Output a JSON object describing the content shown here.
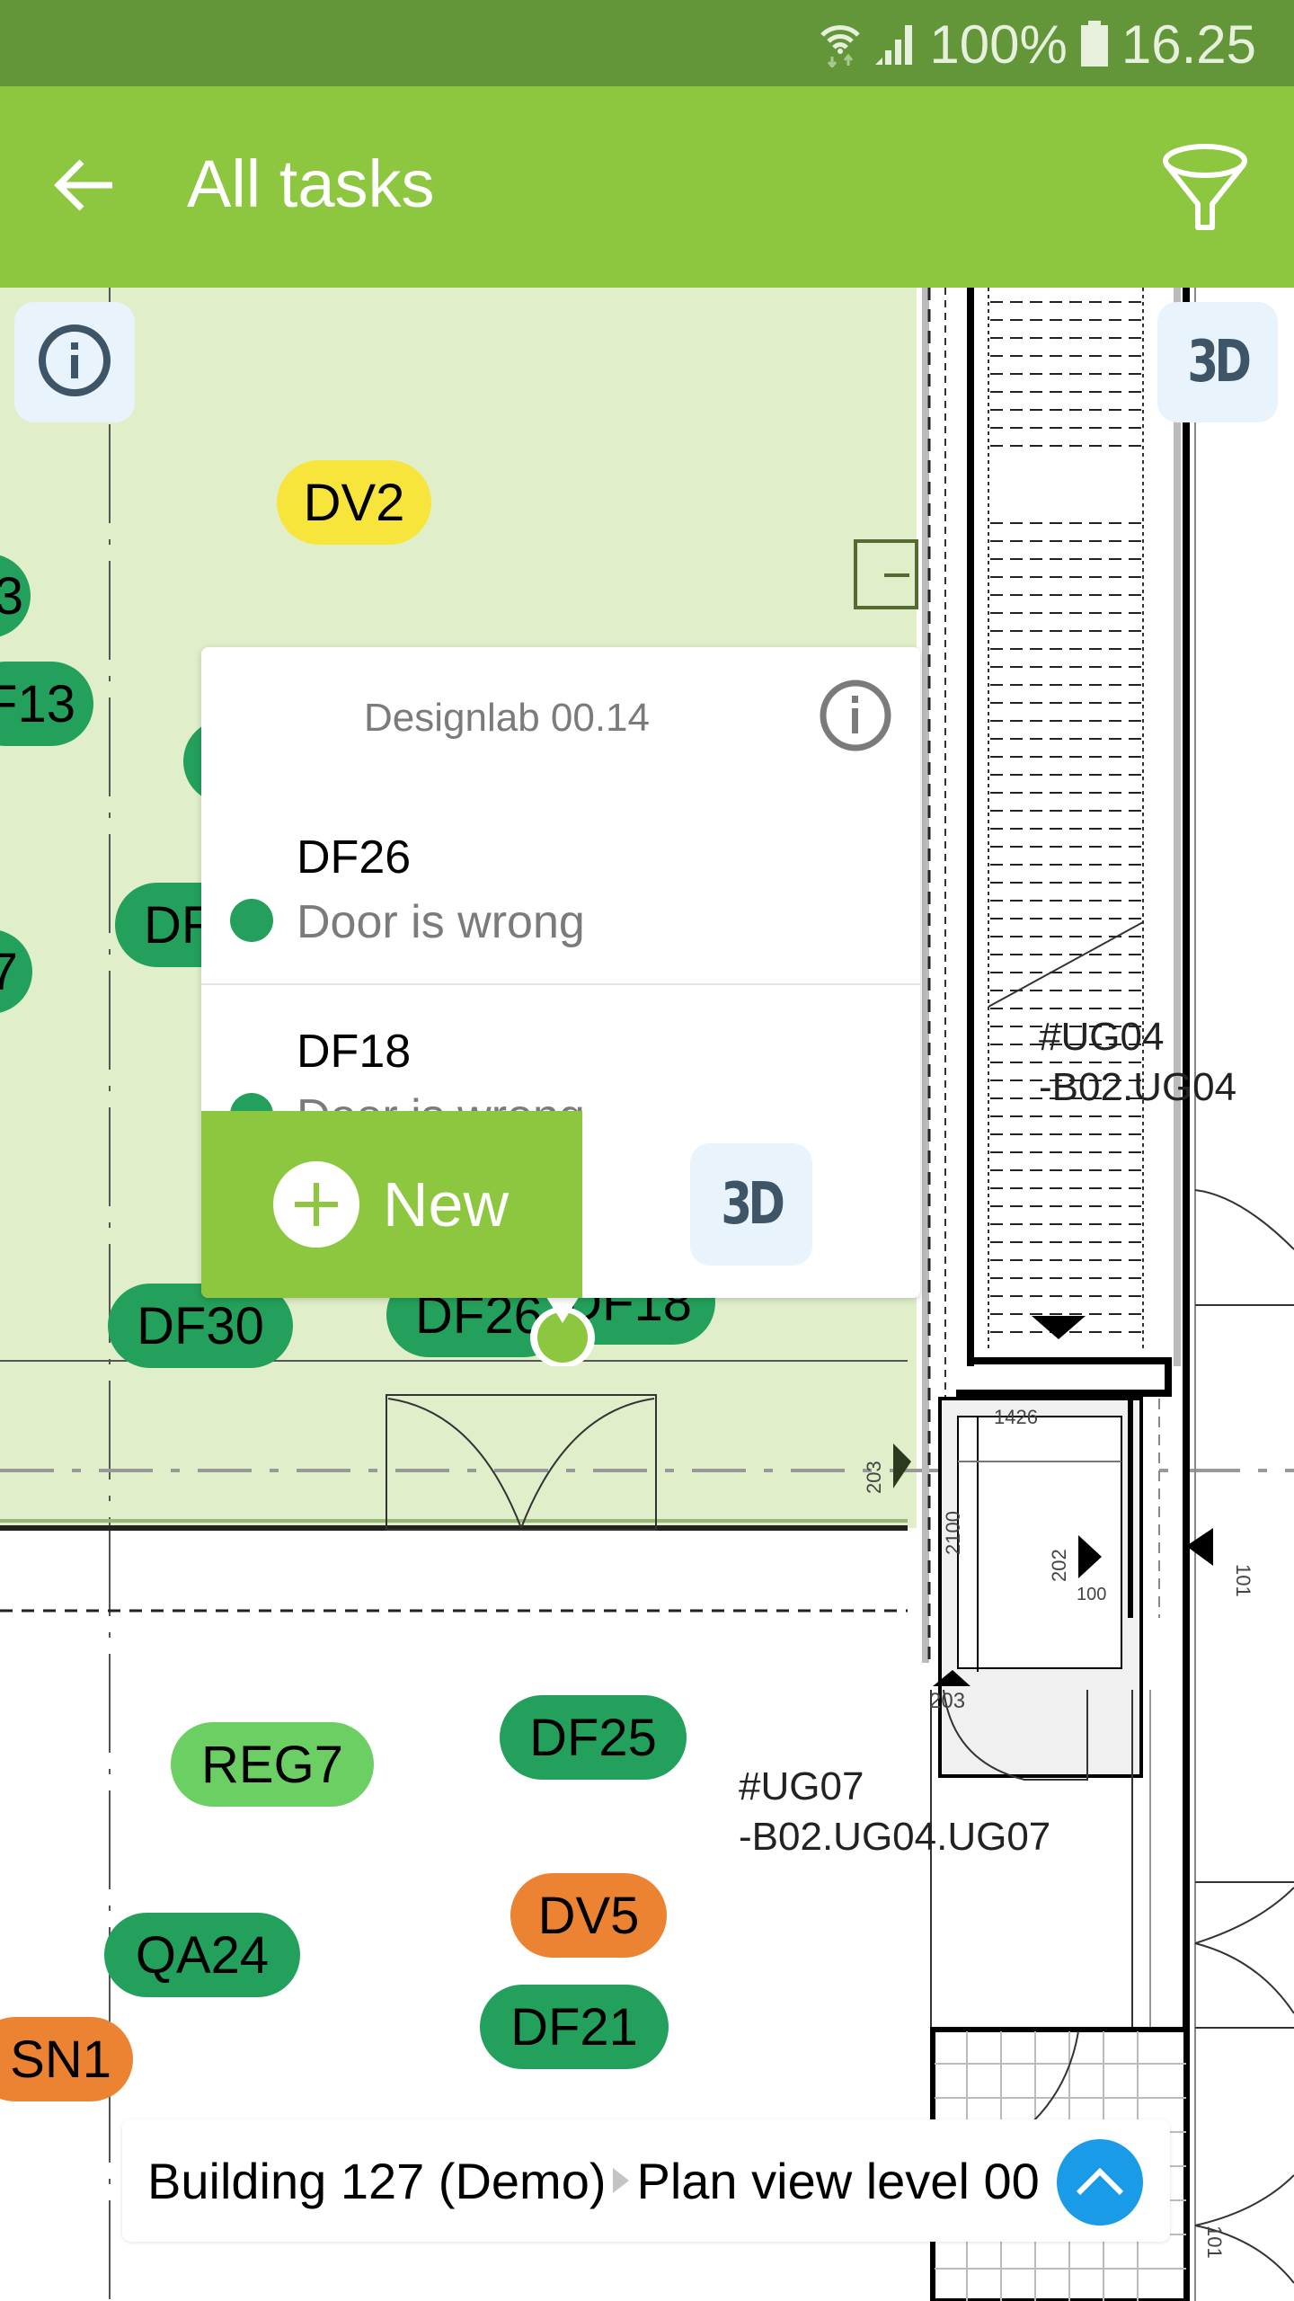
{
  "status_bar": {
    "battery_percent": "100%",
    "time": "16.25",
    "icons": [
      "wifi-icon",
      "signal-icon",
      "battery-icon"
    ]
  },
  "app_bar": {
    "title": "All tasks",
    "back_icon": "arrow-left-icon",
    "filter_icon": "funnel-filter-icon"
  },
  "map": {
    "info_button_icon": "info-icon",
    "three_d_label": "3D",
    "room_labels": [
      {
        "line1": "#UG04",
        "line2": "-B02.UG04"
      },
      {
        "line1": "#UG07",
        "line2": "-B02.UG04.UG07"
      }
    ],
    "dimension_labels": [
      "1426",
      "2100",
      "202",
      "100",
      "203",
      "203",
      "101",
      "101"
    ],
    "pins": [
      {
        "label": "DV2",
        "status": "yellow"
      },
      {
        "label": "3",
        "status": "green"
      },
      {
        "label": "F13",
        "status": "green"
      },
      {
        "label": "",
        "status": "green"
      },
      {
        "label": "DF",
        "status": "green"
      },
      {
        "label": "7",
        "status": "green"
      },
      {
        "label": "DF30",
        "status": "green"
      },
      {
        "label": "DF26",
        "status": "green"
      },
      {
        "label": "DF18",
        "status": "green"
      },
      {
        "label": "REG7",
        "status": "lightgreen"
      },
      {
        "label": "DF25",
        "status": "green"
      },
      {
        "label": "DV5",
        "status": "orange"
      },
      {
        "label": "QA24",
        "status": "green"
      },
      {
        "label": "DF21",
        "status": "green"
      },
      {
        "label": "SN1",
        "status": "orange"
      }
    ]
  },
  "popup": {
    "title": "Designlab 00.14",
    "info_icon": "info-icon",
    "tasks": [
      {
        "id": "DF26",
        "description": "Door is wrong",
        "status_color": "#23a05b"
      },
      {
        "id": "DF18",
        "description": "Door is wrong",
        "status_color": "#23a05b"
      }
    ],
    "new_button_label": "New",
    "three_d_label": "3D"
  },
  "breadcrumb": {
    "items": [
      "Building 127 (Demo)",
      "Plan view level 00"
    ],
    "expand_icon": "chevron-up-icon"
  },
  "colors": {
    "status_bar": "#629639",
    "app_bar": "#8dc63f",
    "room_highlight": "#e0efca",
    "pin_green": "#23a05b",
    "pin_lightgreen": "#6ccf63",
    "pin_yellow": "#f7e53c",
    "pin_orange": "#ec8333",
    "expand_button": "#1a9be8",
    "tool_button_bg": "#e8f3fc"
  }
}
